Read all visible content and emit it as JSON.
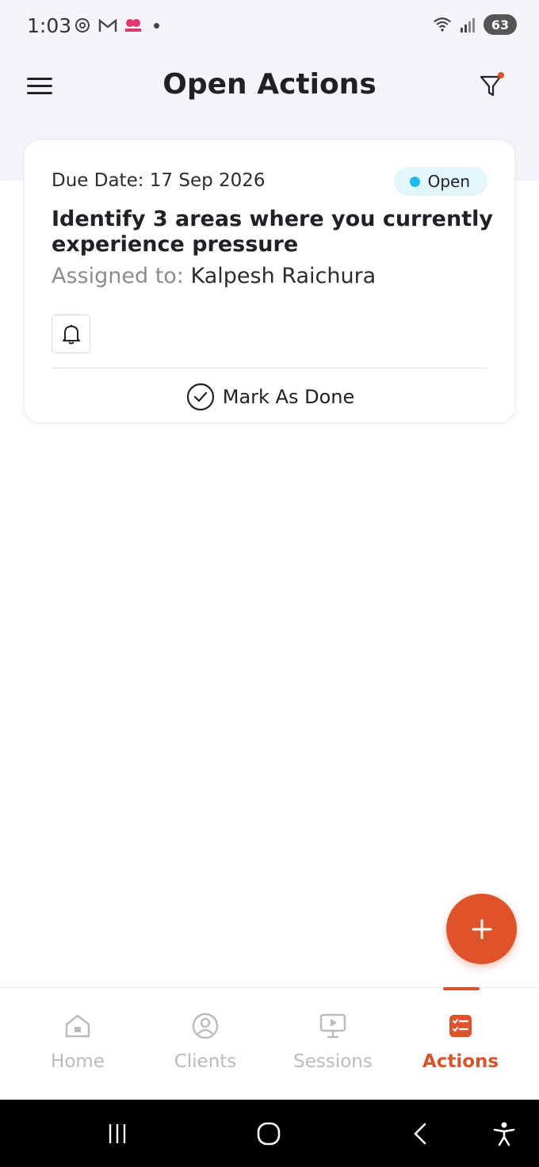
{
  "status_bar": {
    "time": "1:03",
    "battery": "63",
    "left_icons": [
      "threads-icon",
      "gmail-icon",
      "hood-icon"
    ],
    "right_icons": [
      "wifi-icon",
      "signal-icon"
    ]
  },
  "header": {
    "title": "Open Actions",
    "menu_icon": "menu-icon",
    "filter_icon": "filter-icon"
  },
  "action_card": {
    "due_date": "Due Date: 17 Sep 2026",
    "status": "Open",
    "status_color": "#19b9ea",
    "title": "Identify 3 areas where you currently experience pressure",
    "assigned_label": "Assigned to:",
    "assigned_name": "Kalpesh Raichura",
    "mark_done_label": "Mark As Done"
  },
  "fab": {
    "icon": "plus-icon",
    "color": "#e0522a"
  },
  "bottom_nav": {
    "items": [
      {
        "label": "Home",
        "icon": "home-icon",
        "active": false
      },
      {
        "label": "Clients",
        "icon": "user-circle-icon",
        "active": false
      },
      {
        "label": "Sessions",
        "icon": "presentation-icon",
        "active": false
      },
      {
        "label": "Actions",
        "icon": "checklist-icon",
        "active": true
      }
    ],
    "accent": "#d9532b"
  }
}
